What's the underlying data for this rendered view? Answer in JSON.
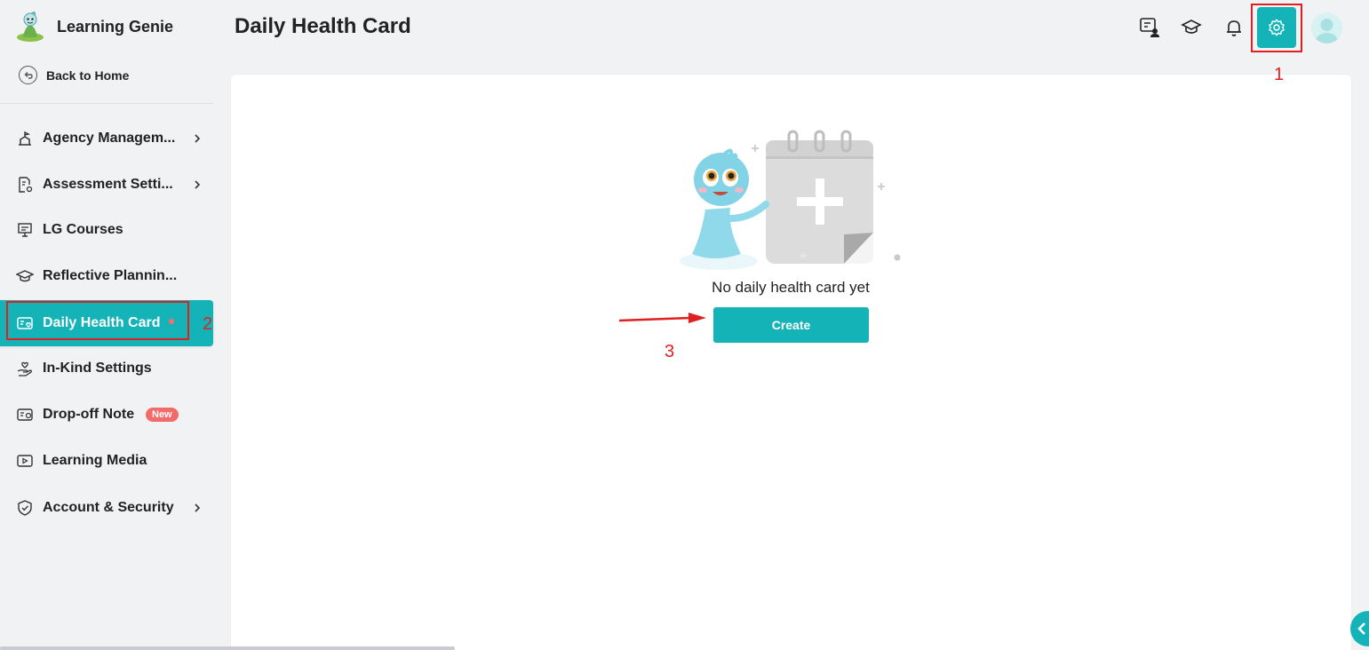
{
  "app": {
    "name": "Learning Genie"
  },
  "nav": {
    "back_label": "Back to Home"
  },
  "sidebar": {
    "items": [
      {
        "label": "Agency Managem...",
        "icon": "agency-icon",
        "has_chevron": true
      },
      {
        "label": "Assessment Setti...",
        "icon": "assessment-settings-icon",
        "has_chevron": true
      },
      {
        "label": "LG Courses",
        "icon": "presentation-board-icon",
        "has_chevron": false
      },
      {
        "label": "Reflective Plannin...",
        "icon": "graduation-cap-icon",
        "has_chevron": false
      },
      {
        "label": "Daily Health Card",
        "icon": "health-card-icon",
        "has_chevron": false,
        "active": true
      },
      {
        "label": "In-Kind Settings",
        "icon": "hand-heart-icon",
        "has_chevron": false
      },
      {
        "label": "Drop-off Note",
        "icon": "note-card-icon",
        "has_chevron": false,
        "badge": "New"
      },
      {
        "label": "Learning Media",
        "icon": "play-video-icon",
        "has_chevron": false
      },
      {
        "label": "Account & Security",
        "icon": "shield-check-icon",
        "has_chevron": true
      }
    ]
  },
  "header": {
    "title": "Daily Health Card",
    "icons": [
      "chat-user-icon",
      "graduation-cap-icon",
      "bell-icon",
      "gear-icon",
      "avatar"
    ]
  },
  "empty_state": {
    "message": "No daily health card yet",
    "create_label": "Create"
  },
  "annotations": {
    "one": "1",
    "two": "2",
    "three": "3"
  },
  "colors": {
    "accent": "#14b3b8",
    "annotation_red": "#e02020",
    "badge_red": "#f26b6b",
    "background": "#f1f2f4"
  }
}
